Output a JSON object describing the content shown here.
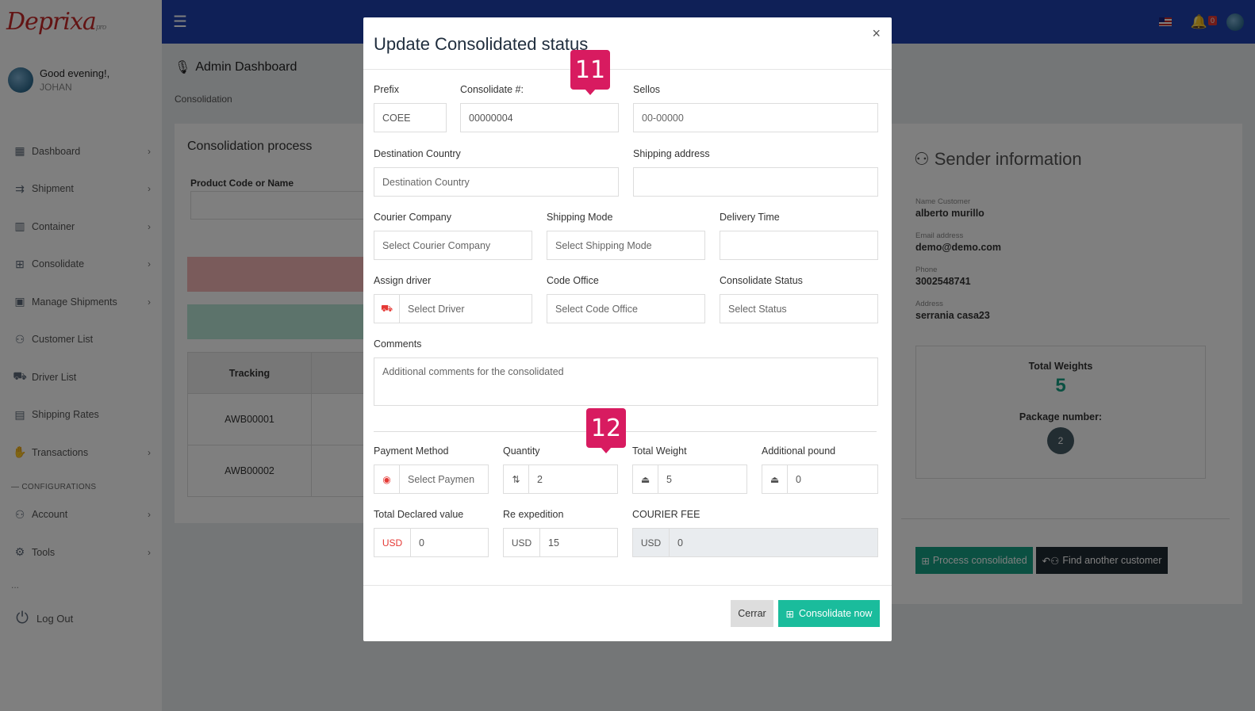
{
  "brand": {
    "name": "Deprixa",
    "suffix": "pro"
  },
  "user": {
    "greeting": "Good evening!,",
    "name": "JOHAN"
  },
  "topbar": {
    "notifications_count": "0"
  },
  "sidebar": {
    "items": [
      {
        "label": "Dashboard",
        "icon": "dashboard-icon",
        "glyph": "▦",
        "arrow": true
      },
      {
        "label": "Shipment",
        "icon": "shipment-icon",
        "glyph": "⇉",
        "arrow": true
      },
      {
        "label": "Container",
        "icon": "container-icon",
        "glyph": "▥",
        "arrow": true
      },
      {
        "label": "Consolidate",
        "icon": "gift-icon",
        "glyph": "⊞",
        "arrow": true
      },
      {
        "label": "Manage Shipments",
        "icon": "box-icon",
        "glyph": "▣",
        "arrow": true
      },
      {
        "label": "Customer List",
        "icon": "users-icon",
        "glyph": "⚇",
        "arrow": false
      },
      {
        "label": "Driver List",
        "icon": "car-icon",
        "glyph": "⛟",
        "arrow": false
      },
      {
        "label": "Shipping Rates",
        "icon": "rates-icon",
        "glyph": "▤",
        "arrow": false
      },
      {
        "label": "Transactions",
        "icon": "hand-coin-icon",
        "glyph": "✋",
        "arrow": true
      }
    ],
    "section_label": "— CONFIGURATIONS",
    "config_items": [
      {
        "label": "Account",
        "icon": "account-icon",
        "glyph": "⚇",
        "arrow": true
      },
      {
        "label": "Tools",
        "icon": "gear-icon",
        "glyph": "⚙",
        "arrow": true
      }
    ],
    "dots": "...",
    "logout": "Log Out"
  },
  "main": {
    "title": "Admin Dashboard",
    "breadcrumb": "Consolidation",
    "process_title": "Consolidation process",
    "product_label": "Product Code or Name",
    "table": {
      "header": "Tracking",
      "rows": [
        "AWB00001",
        "AWB00002"
      ]
    }
  },
  "sender": {
    "title": "Sender information",
    "fields": [
      {
        "label": "Name Customer",
        "value": "alberto murillo"
      },
      {
        "label": "Email address",
        "value": "demo@demo.com"
      },
      {
        "label": "Phone",
        "value": "3002548741"
      },
      {
        "label": "Address",
        "value": "serrania casa23"
      }
    ],
    "total_weights_label": "Total Weights",
    "total_weights_value": "5",
    "package_number_label": "Package number:",
    "package_number_value": "2",
    "process_button": "Process consolidated",
    "find_button": "Find another customer"
  },
  "modal": {
    "title": "Update Consolidated status",
    "close": "×",
    "prefix": {
      "label": "Prefix",
      "value": "COEE"
    },
    "consolidate_no": {
      "label": "Consolidate #:",
      "value": "00000004"
    },
    "sellos": {
      "label": "Sellos",
      "placeholder": "00-00000"
    },
    "destination_country": {
      "label": "Destination Country",
      "placeholder": "Destination Country"
    },
    "shipping_address": {
      "label": "Shipping address",
      "value": ""
    },
    "courier_company": {
      "label": "Courier Company",
      "placeholder": "Select Courier Company"
    },
    "shipping_mode": {
      "label": "Shipping Mode",
      "placeholder": "Select Shipping Mode"
    },
    "delivery_time": {
      "label": "Delivery Time",
      "value": ""
    },
    "assign_driver": {
      "label": "Assign driver",
      "placeholder": "Select Driver"
    },
    "code_office": {
      "label": "Code Office",
      "placeholder": "Select Code Office"
    },
    "consolidate_status": {
      "label": "Consolidate Status",
      "placeholder": "Select Status"
    },
    "comments": {
      "label": "Comments",
      "placeholder": "Additional comments for the consolidated"
    },
    "payment_method": {
      "label": "Payment Method",
      "placeholder": "Select Paymen"
    },
    "quantity": {
      "label": "Quantity",
      "value": "2"
    },
    "total_weight": {
      "label": "Total Weight",
      "value": "5"
    },
    "additional_pound": {
      "label": "Additional pound",
      "value": "0"
    },
    "total_declared": {
      "label": "Total Declared value",
      "currency": "USD",
      "value": "0"
    },
    "re_expedition": {
      "label": "Re expedition",
      "currency": "USD",
      "value": "15"
    },
    "courier_fee": {
      "label": "COURIER FEE",
      "currency": "USD",
      "value": "0"
    },
    "cancel_button": "Cerrar",
    "submit_button": "Consolidate now"
  },
  "callouts": [
    "11",
    "12"
  ]
}
